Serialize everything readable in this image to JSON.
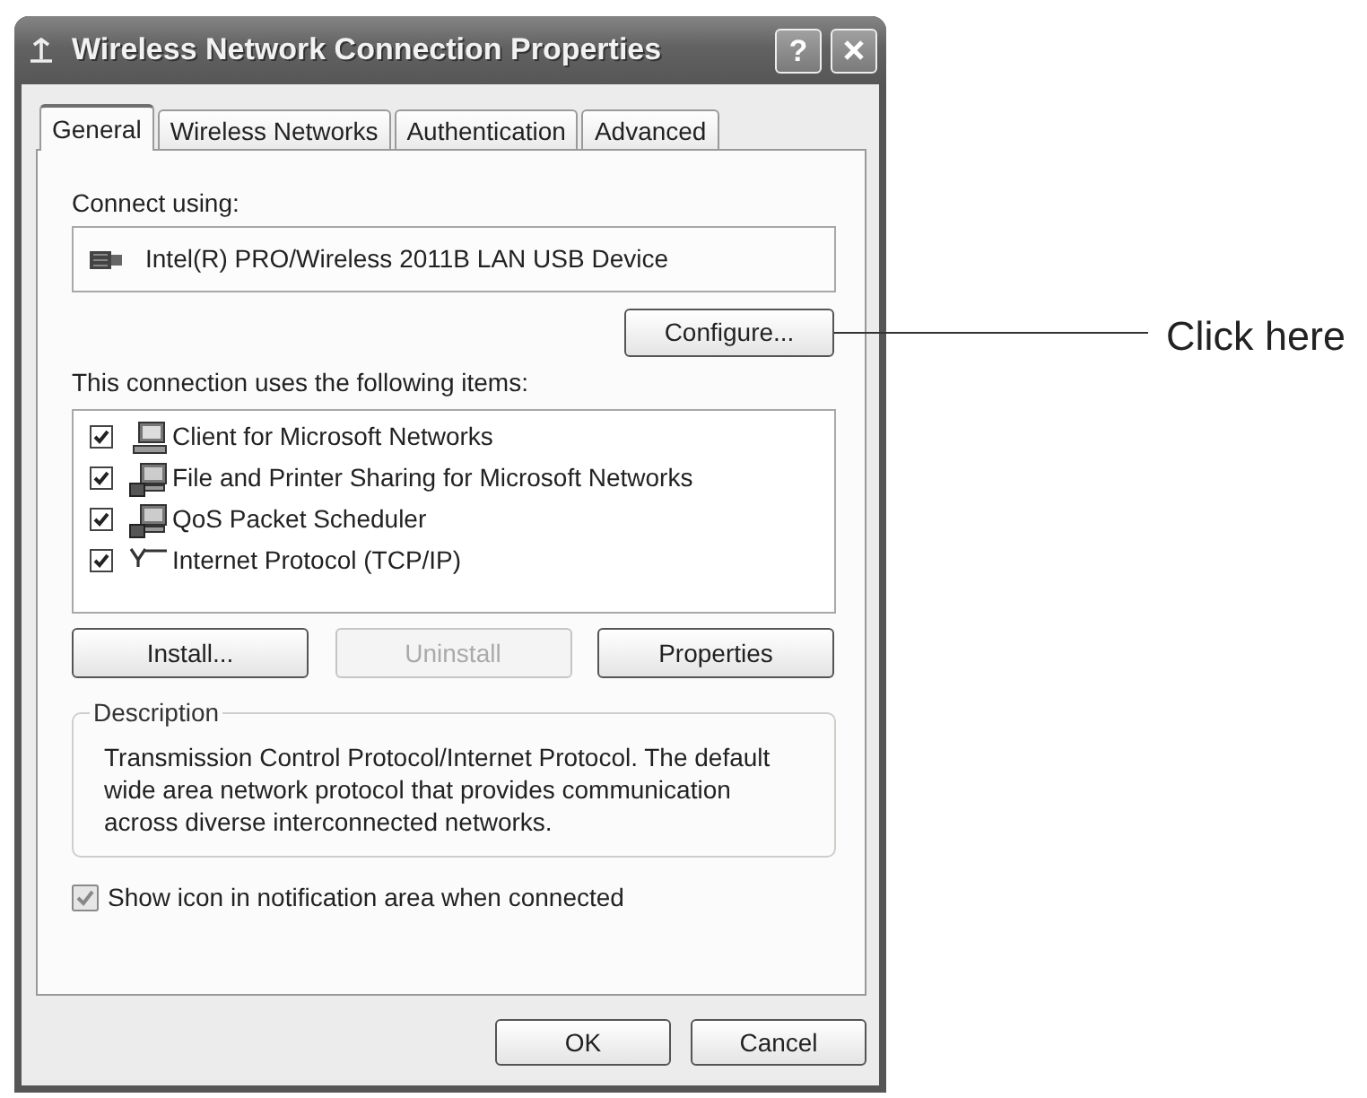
{
  "window": {
    "title": "Wireless Network Connection Properties",
    "help_button": "?"
  },
  "tabs": [
    {
      "label": "General",
      "selected": true
    },
    {
      "label": "Wireless Networks",
      "selected": false
    },
    {
      "label": "Authentication",
      "selected": false
    },
    {
      "label": "Advanced",
      "selected": false
    }
  ],
  "connect_using": {
    "label": "Connect using:",
    "device": "Intel(R) PRO/Wireless 2011B LAN USB Device",
    "configure_button": "Configure..."
  },
  "components": {
    "label": "This connection uses the following items:",
    "items": [
      {
        "name": "Client for Microsoft Networks",
        "kind": "client",
        "checked": true
      },
      {
        "name": "File and Printer Sharing for Microsoft Networks",
        "kind": "service",
        "checked": true
      },
      {
        "name": "QoS Packet Scheduler",
        "kind": "service",
        "checked": true
      },
      {
        "name": "Internet Protocol (TCP/IP)",
        "kind": "protocol",
        "checked": true
      }
    ]
  },
  "component_buttons": [
    {
      "label": "Install...",
      "disabled": false
    },
    {
      "label": "Uninstall",
      "disabled": true
    },
    {
      "label": "Properties",
      "disabled": false
    }
  ],
  "description": {
    "title": "Description",
    "text": "Transmission Control Protocol/Internet Protocol. The default wide area network protocol that provides communication across diverse interconnected networks."
  },
  "show_icon": {
    "label": "Show icon in notification area when connected",
    "checked": true
  },
  "dialog_buttons": [
    "OK",
    "Cancel"
  ],
  "callout": {
    "text": "Click here"
  }
}
